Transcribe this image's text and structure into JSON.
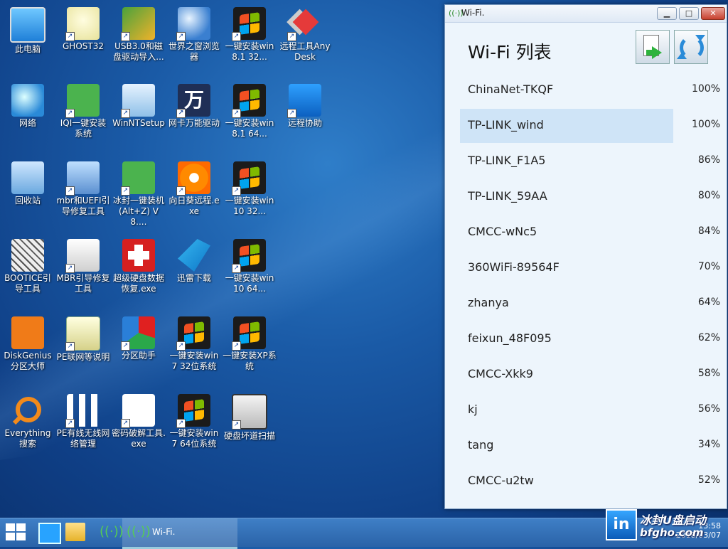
{
  "desktop": {
    "icons": [
      {
        "label": "此电脑",
        "icon": "computer-icon"
      },
      {
        "label": "GHOST32",
        "icon": "ghost-icon"
      },
      {
        "label": "USB3.0和磁盘驱动导入...",
        "icon": "usb-driver-icon"
      },
      {
        "label": "世界之窗浏览器",
        "icon": "browser-globe-icon"
      },
      {
        "label": "一键安装win8.1 32...",
        "icon": "windows-flag-icon"
      },
      {
        "label": "远程工具AnyDesk",
        "icon": "anydesk-icon"
      },
      {
        "label": "网络",
        "icon": "network-globe-icon"
      },
      {
        "label": "IQI一键安装系统",
        "icon": "iqi-ghost-icon"
      },
      {
        "label": "WinNTSetup",
        "icon": "winntsetup-icon"
      },
      {
        "label": "网卡万能驱动",
        "icon": "wan-driver-icon"
      },
      {
        "label": "一键安装win8.1 64...",
        "icon": "windows-flag-icon"
      },
      {
        "label": "远程协助",
        "icon": "teamviewer-icon"
      },
      {
        "label": "回收站",
        "icon": "recycle-bin-icon"
      },
      {
        "label": "mbr和UEFI引导修复工具",
        "icon": "boot-repair-icon"
      },
      {
        "label": "冰封一键装机(Alt+Z) V8....",
        "icon": "bingfeng-ghost-icon"
      },
      {
        "label": "向日葵远程.exe",
        "icon": "sunflower-icon"
      },
      {
        "label": "一键安装win10 32...",
        "icon": "windows-flag-icon"
      },
      {
        "label": "BOOTICE引导工具",
        "icon": "bootice-icon"
      },
      {
        "label": "MBR引导修复工具",
        "icon": "first-aid-kit-icon"
      },
      {
        "label": "超级硬盘数据恢复.exe",
        "icon": "red-cross-icon"
      },
      {
        "label": "迅雷下载",
        "icon": "thunder-icon"
      },
      {
        "label": "一键安装win10 64...",
        "icon": "windows-flag-icon"
      },
      {
        "label": "DiskGenius分区大师",
        "icon": "diskgenius-icon"
      },
      {
        "label": "PE联网等说明",
        "icon": "pdf-document-icon"
      },
      {
        "label": "分区助手",
        "icon": "partition-icon"
      },
      {
        "label": "一键安装win7 32位系统",
        "icon": "windows-flag-icon"
      },
      {
        "label": "一键安装XP系统",
        "icon": "windows-flag-icon"
      },
      {
        "label": "Everything搜索",
        "icon": "search-magnifier-icon"
      },
      {
        "label": "PE有线无线网络管理",
        "icon": "network-topology-icon"
      },
      {
        "label": "密码破解工具.exe",
        "icon": "key-icon"
      },
      {
        "label": "一键安装win7 64位系统",
        "icon": "windows-flag-icon"
      },
      {
        "label": "硬盘坏道扫描",
        "icon": "hdd-scan-icon"
      }
    ]
  },
  "window": {
    "title": "Wi-Fi.",
    "minimize_label": "▁",
    "maximize_label": "□",
    "close_label": "✕"
  },
  "wifi": {
    "heading": "Wi-Fi 列表",
    "export_button_icon": "export-file-icon",
    "refresh_button_icon": "refresh-icon",
    "networks": [
      {
        "ssid": "ChinaNet-TKQF",
        "signal": "100%"
      },
      {
        "ssid": "TP-LINK_wind",
        "signal": "100%"
      },
      {
        "ssid": "TP-LINK_F1A5",
        "signal": "86%"
      },
      {
        "ssid": "TP-LINK_59AA",
        "signal": "80%"
      },
      {
        "ssid": "CMCC-wNc5",
        "signal": "84%"
      },
      {
        "ssid": "360WiFi-89564F",
        "signal": "70%"
      },
      {
        "ssid": "zhanya",
        "signal": "64%"
      },
      {
        "ssid": "feixun_48F095",
        "signal": "62%"
      },
      {
        "ssid": "CMCC-Xkk9",
        "signal": "58%"
      },
      {
        "ssid": "kj",
        "signal": "56%"
      },
      {
        "ssid": "tang",
        "signal": "34%"
      },
      {
        "ssid": "CMCC-u2tw",
        "signal": "52%"
      }
    ],
    "selected_ssid": "TP-LINK_wind"
  },
  "taskbar": {
    "wifi_task_label": "Wi-Fi.",
    "time": "13:58",
    "date": "2018/03/07"
  },
  "watermark": {
    "line1": "冰封U盘启动",
    "line2": "bfgho.com",
    "logo_text": "in"
  }
}
